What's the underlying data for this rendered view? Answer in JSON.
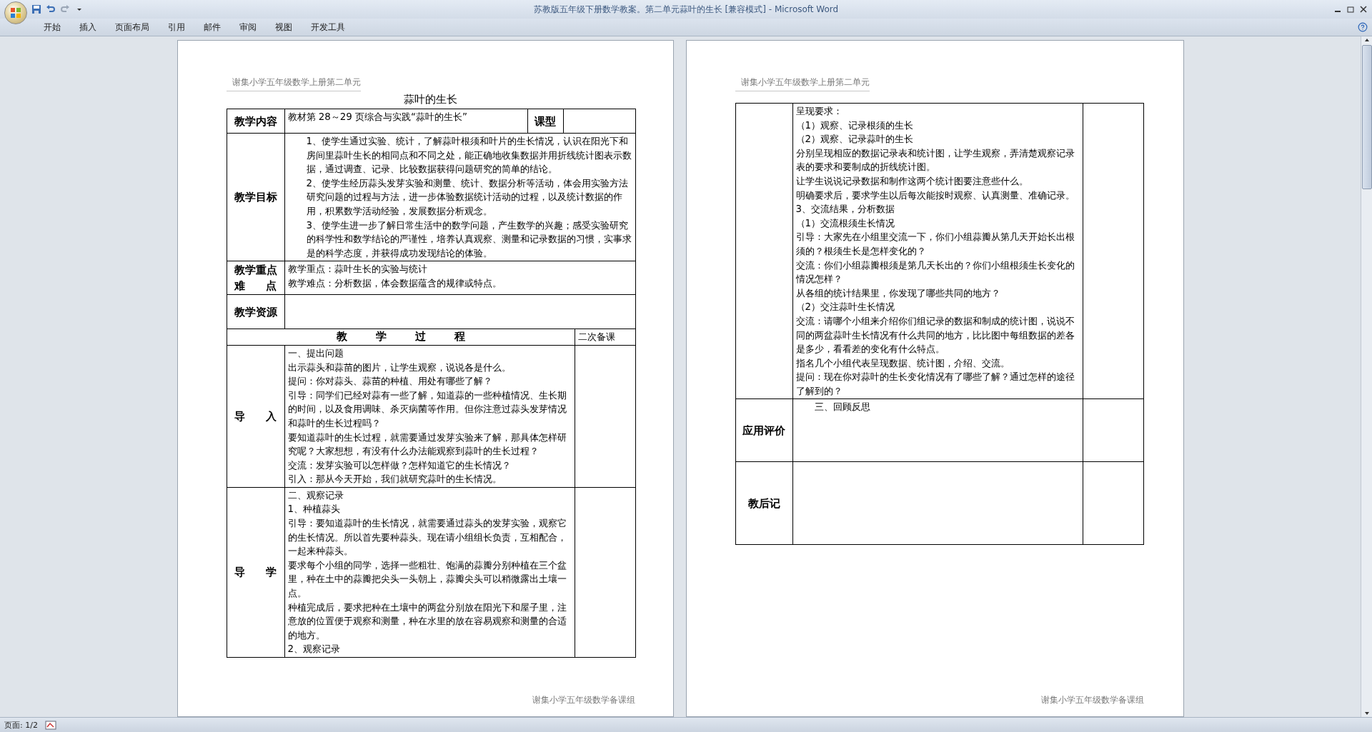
{
  "window": {
    "title": "苏教版五年级下册数学教案。第二单元蒜叶的生长 [兼容模式] - Microsoft Word"
  },
  "ribbon": {
    "tabs": [
      "开始",
      "插入",
      "页面布局",
      "引用",
      "邮件",
      "审阅",
      "视图",
      "开发工具"
    ]
  },
  "page_1": {
    "header": "谢集小学五年级数学上册第二单元",
    "title": "蒜叶的生长",
    "info_rows": [
      {
        "kind": "typed",
        "label": "教学内容",
        "paragraphs": [
          "教材第 28～29 页综合与实践“蒜叶的生长”"
        ],
        "type_label": "课型"
      },
      {
        "kind": "plain",
        "label": "教学目标",
        "indented": true,
        "paragraphs": [
          "1、使学生通过实验、统计，了解蒜叶根须和叶片的生长情况，认识在阳光下和房间里蒜叶生长的相同点和不同之处，能正确地收集数据并用折线统计图表示数据，通过调查、记录、比较数据获得问题研究的简单的结论。",
          "2、使学生经历蒜头发芽实验和测量、统计、数据分析等活动，体会用实验方法研究问题的过程与方法，进一步体验数据统计活动的过程，以及统计数据的作用，积累数学活动经验，发展数据分析观念。",
          "3、使学生进一步了解日常生活中的数学问题，产生数学的兴趣；感受实验研究的科学性和数学结论的严谨性，培养认真观察、测量和记录数据的习惯，实事求是的科学态度，并获得成功发现结论的体验。"
        ]
      },
      {
        "kind": "plain",
        "label": "教学重点难点",
        "paragraphs": [
          "教学重点：蒜叶生长的实验与统计",
          "教学难点：分析数据，体会数据蕴含的规律或特点。"
        ]
      },
      {
        "kind": "plain",
        "label": "教学资源"
      }
    ],
    "process": {
      "heading": "教学过程",
      "notes_heading": "二次备课",
      "sections": [
        {
          "label": "导入",
          "paragraphs": [
            "一、提出问题",
            "出示蒜头和蒜苗的图片，让学生观察，说说各是什么。",
            "提问：你对蒜头、蒜苗的种植、用处有哪些了解？",
            "引导：同学们已经对蒜有一些了解，知道蒜的一些种植情况、生长期的时间，以及食用调味、杀灭病菌等作用。但你注意过蒜头发芽情况和蒜叶的生长过程吗？",
            "要知道蒜叶的生长过程，就需要通过发芽实验来了解，那具体怎样研究呢？大家想想，有没有什么办法能观察到蒜叶的生长过程？",
            "交流：发芽实验可以怎样做？怎样知道它的生长情况？",
            "引入：那从今天开始，我们就研究蒜叶的生长情况。"
          ]
        },
        {
          "label": "导学",
          "paragraphs": [
            "二、观察记录",
            "1、种植蒜头",
            "引导：要知道蒜叶的生长情况，就需要通过蒜头的发芽实验，观察它的生长情况。所以首先要种蒜头。现在请小组组长负责，互相配合，一起来种蒜头。",
            "要求每个小组的同学，选择一些粗壮、饱满的蒜瓣分别种植在三个盆里，种在土中的蒜瓣把尖头一头朝上，蒜瓣尖头可以稍微露出土壤一点。",
            "种植完成后，要求把种在土壤中的两盆分别放在阳光下和屋子里，注意放的位置便于观察和测量，种在水里的放在容易观察和测量的合适的地方。",
            "2、观察记录"
          ]
        }
      ]
    },
    "footer": "谢集小学五年级数学备课组"
  },
  "page_2": {
    "header": "谢集小学五年级数学上册第二单元",
    "sections": [
      {
        "paragraphs": [
          "呈现要求：",
          "（1）观察、记录根须的生长",
          "（2）观察、记录蒜叶的生长",
          "分别呈现相应的数据记录表和统计图，让学生观察，弄清楚观察记录表的要求和要制成的折线统计图。",
          "让学生说说记录数据和制作这两个统计图要注意些什么。",
          "明确要求后，要求学生以后每次能按时观察、认真测量、准确记录。",
          "3、交流结果，分析数据",
          "（1）交流根须生长情况",
          "引导：大家先在小组里交流一下，你们小组蒜瓣从第几天开始长出根须的？根须生长是怎样变化的？",
          "交流：你们小组蒜瓣根须是第几天长出的？你们小组根须生长变化的情况怎样？",
          "从各组的统计结果里，你发现了哪些共同的地方？",
          "（2）交注蒜叶生长情况",
          "交流：请哪个小组来介绍你们组记录的数据和制成的统计图，说说不同的两盆蒜叶生长情况有什么共同的地方，比比图中每组数据的差各是多少，看看差的变化有什么特点。",
          "指名几个小组代表呈现数据、统计图，介绍、交流。",
          "提问：现在你对蒜叶的生长变化情况有了哪些了解？通过怎样的途径了解到的？"
        ]
      },
      {
        "label": "应用评价",
        "indented": true,
        "paragraphs": [
          "三、回顾反思"
        ]
      },
      {
        "label": "教后记"
      }
    ],
    "footer": "谢集小学五年级数学备课组"
  },
  "status_bar": {
    "page": "页面: 1/2"
  }
}
